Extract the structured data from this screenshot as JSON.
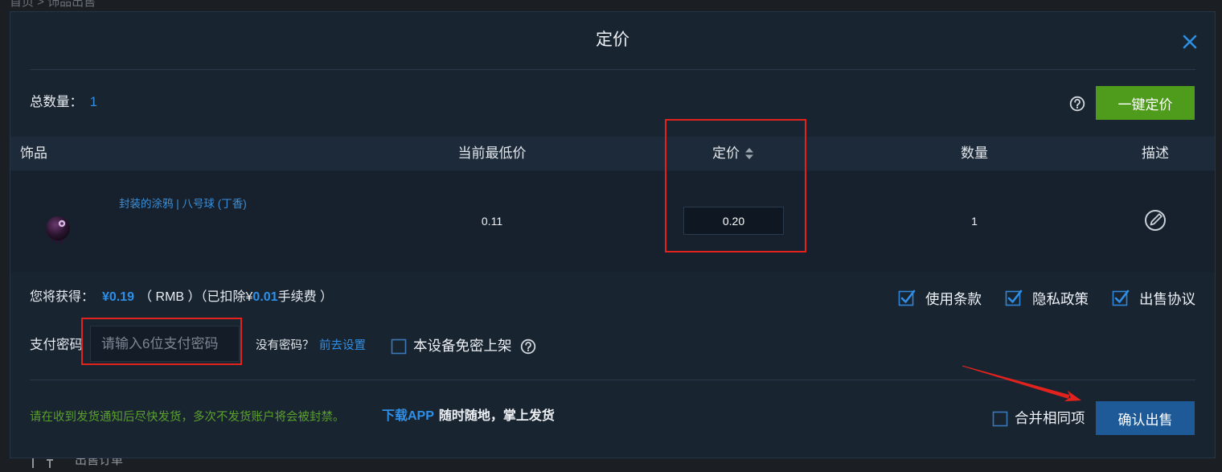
{
  "page": {
    "breadcrumb": "首页 > 饰品出售",
    "bottom_tab": "出售订单"
  },
  "dialog": {
    "title": "定价",
    "summary": {
      "total_label": "总数量：",
      "total_value": "1"
    },
    "one_click_button": "一键定价",
    "table": {
      "columns": [
        "饰品",
        "当前最低价",
        "定价",
        "数量",
        "描述"
      ],
      "rows": [
        {
          "item_name": "封装的涂鸦 | 八号球 (丁香)",
          "lowest_price": "0.11",
          "price": "0.20",
          "quantity": "1"
        }
      ]
    },
    "earnings": {
      "label": "您将获得：",
      "amount": "¥0.19",
      "currency": "（ RMB ）",
      "fee_prefix": "（已扣除¥",
      "fee": "0.01",
      "fee_suffix": "手续费 ）"
    },
    "agreements": [
      {
        "label": "使用条款",
        "checked": true
      },
      {
        "label": "隐私政策",
        "checked": true
      },
      {
        "label": "出售协议",
        "checked": true
      }
    ],
    "payment": {
      "label": "支付密码",
      "placeholder": "请输入6位支付密码",
      "no_password_text": "没有密码？",
      "set_link": "前去设置",
      "remember_device_label": "本设备免密上架",
      "remember_device_checked": false
    },
    "footer": {
      "warning": "请在收到发货通知后尽快发货，多次不发货账户将会被封禁。",
      "app_link": "下载APP",
      "app_slogan": "随时随地，掌上发货",
      "merge_label": "合并相同项",
      "merge_checked": false,
      "confirm_button": "确认出售"
    }
  },
  "icons": {
    "close": "close-icon",
    "help": "question-circle-icon",
    "sort": "sort-icon",
    "edit": "edit-icon"
  },
  "colors": {
    "accent_blue": "#2f8fe6",
    "one_click_green": "#4f9b1b",
    "confirm_blue": "#1e5a98",
    "warning_green": "#5aa02c",
    "annotation_red": "#e3221e"
  }
}
